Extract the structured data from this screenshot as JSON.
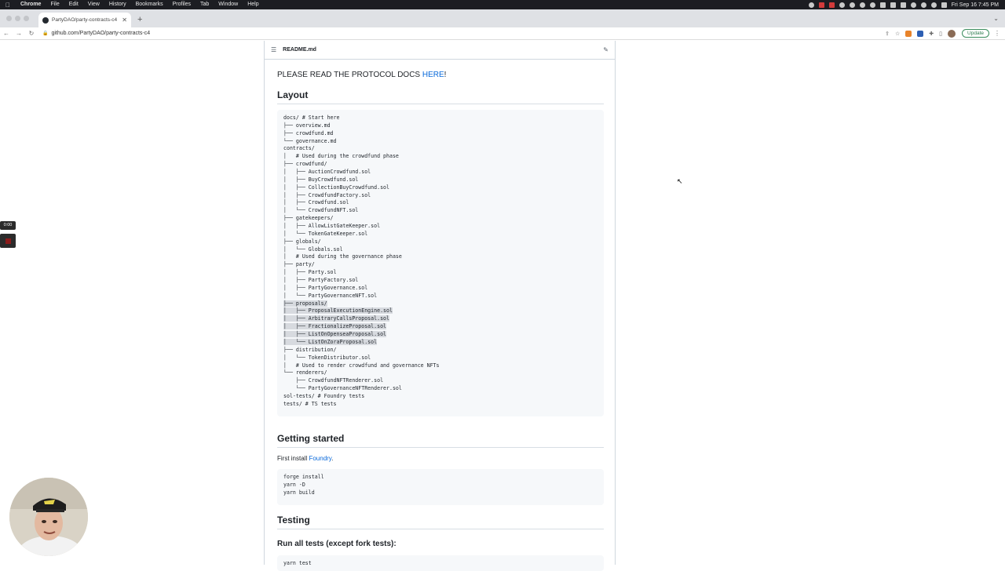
{
  "menubar": {
    "app": "Chrome",
    "items": [
      "File",
      "Edit",
      "View",
      "History",
      "Bookmarks",
      "Profiles",
      "Tab",
      "Window",
      "Help"
    ],
    "clock": "Fri Sep 16 7:45 PM"
  },
  "tab": {
    "title": "PartyDAO/party-contracts-c4"
  },
  "address": {
    "url": "github.com/PartyDAO/party-contracts-c4",
    "update_label": "Update"
  },
  "readme": {
    "filename": "README.md",
    "notice_prefix": "PLEASE READ THE PROTOCOL DOCS ",
    "notice_link": "HERE",
    "notice_suffix": "!",
    "layout_heading": "Layout",
    "tree_lines": [
      "docs/ # Start here",
      "├── overview.md",
      "├── crowdfund.md",
      "└── governance.md",
      "contracts/",
      "│   # Used during the crowdfund phase",
      "├── crowdfund/",
      "│   ├── AuctionCrowdfund.sol",
      "│   ├── BuyCrowdfund.sol",
      "│   ├── CollectionBuyCrowdfund.sol",
      "│   ├── CrowdfundFactory.sol",
      "│   ├── Crowdfund.sol",
      "│   └── CrowdfundNFT.sol",
      "├── gatekeepers/",
      "│   ├── AllowListGateKeeper.sol",
      "│   └── TokenGateKeeper.sol",
      "├── globals/",
      "│   └── Globals.sol",
      "│   # Used during the governance phase",
      "├── party/",
      "│   ├── Party.sol",
      "│   ├── PartyFactory.sol",
      "│   ├── PartyGovernance.sol",
      "│   └── PartyGovernanceNFT.sol",
      "├── proposals/",
      "│   ├── ProposalExecutionEngine.sol",
      "│   ├── ArbitraryCallsProposal.sol",
      "│   ├── FractionalizeProposal.sol",
      "│   ├── ListOnOpenseaProposal.sol",
      "│   └── ListOnZoraProposal.sol",
      "├── distribution/",
      "│   └── TokenDistributor.sol",
      "│   # Used to render crowdfund and governance NFTs",
      "└── renderers/",
      "    ├── CrowdfundNFTRenderer.sol",
      "    └── PartyGovernanceNFTRenderer.sol",
      "sol-tests/ # Foundry tests",
      "tests/ # TS tests"
    ],
    "getting_started_heading": "Getting started",
    "install_prefix": "First install ",
    "install_link": "Foundry",
    "install_suffix": ".",
    "install_code": [
      "forge install",
      "yarn -D",
      "yarn build"
    ],
    "testing_heading": "Testing",
    "run_tests_heading": "Run all tests (except fork tests):",
    "test_code": [
      "yarn test"
    ]
  },
  "recorder": {
    "time": "0:00"
  }
}
